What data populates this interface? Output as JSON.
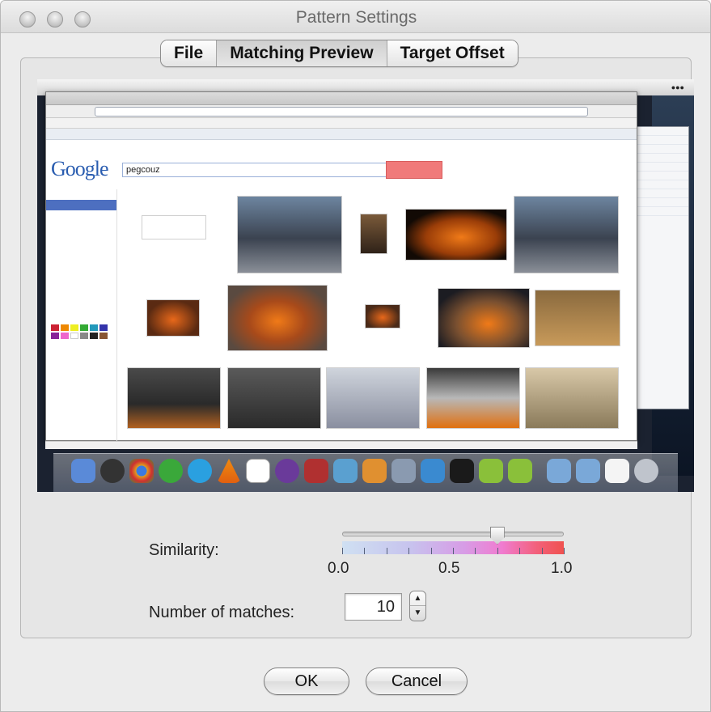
{
  "window": {
    "title": "Pattern Settings"
  },
  "tabs": [
    {
      "label": "File",
      "active": false
    },
    {
      "label": "Matching Preview",
      "active": true
    },
    {
      "label": "Target Offset",
      "active": false
    }
  ],
  "preview": {
    "search_query": "pegcouz",
    "logo_text": "Google"
  },
  "similarity": {
    "label": "Similarity:",
    "value": 0.7,
    "min_label": "0.0",
    "mid_label": "0.5",
    "max_label": "1.0"
  },
  "matches": {
    "label": "Number of matches:",
    "value": "10",
    "up_icon": "triangle-up",
    "down_icon": "triangle-down"
  },
  "buttons": {
    "ok_label": "OK",
    "cancel_label": "Cancel"
  },
  "colors": {
    "accent_red": "#f0524f",
    "accent_blue": "#cfe0f2"
  }
}
